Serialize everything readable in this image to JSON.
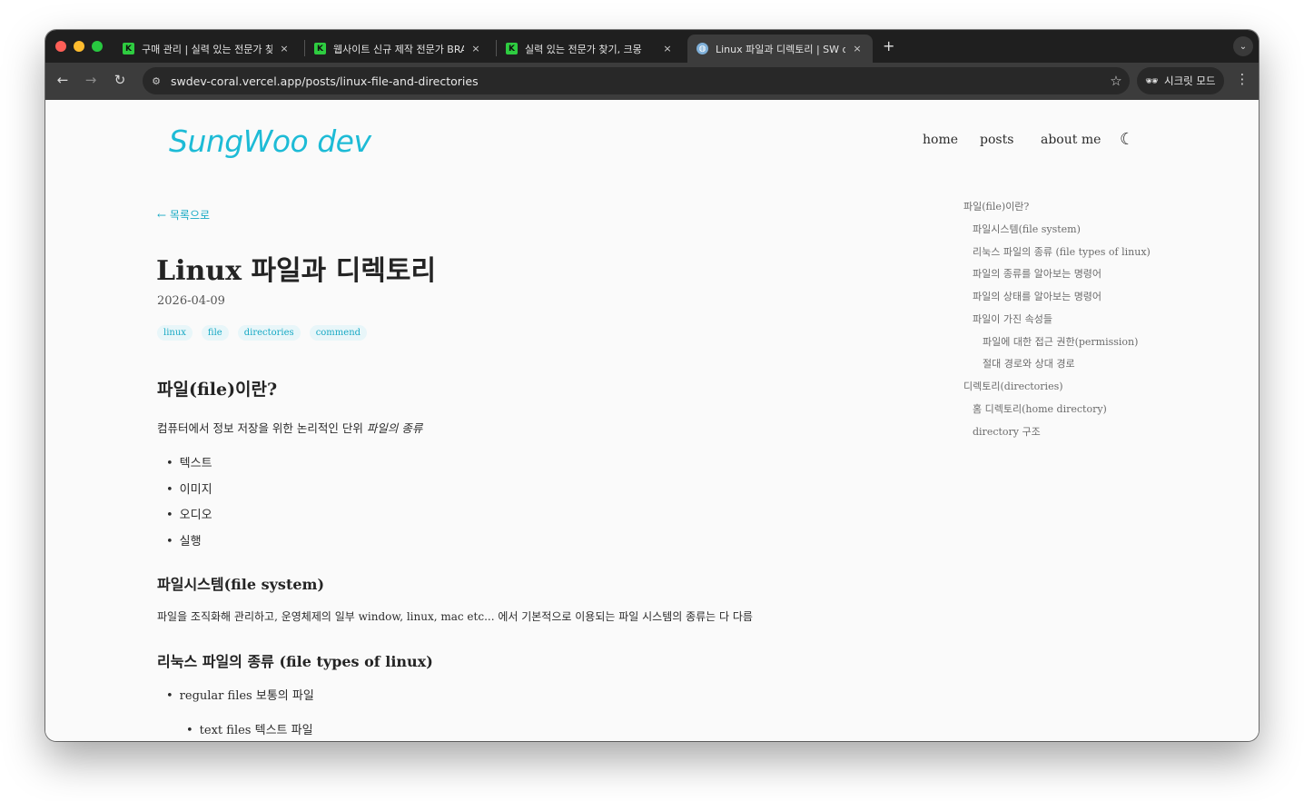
{
  "browser": {
    "tabs": [
      {
        "title": "구매 관리 | 실력 있는 전문가 찾기,",
        "favicon": "K"
      },
      {
        "title": "웹사이트 신규 제작 전문가 BRAZE",
        "favicon": "K"
      },
      {
        "title": "실력 있는 전문가 찾기, 크몽",
        "favicon": "K"
      },
      {
        "title": "Linux 파일과 디렉토리 | SW dev",
        "favicon": "globe"
      }
    ],
    "close_symbol": "×",
    "new_tab_symbol": "+",
    "url": "swdev-coral.vercel.app/posts/linux-file-and-directories",
    "incognito_label": "시크릿 모드"
  },
  "site": {
    "logo": "SungWoo dev",
    "nav": {
      "home": "home",
      "posts": "posts",
      "about": "about me"
    }
  },
  "post": {
    "back_link": "← 목록으로",
    "title": "Linux 파일과 디렉토리",
    "date": "2026-04-09",
    "tags": [
      "linux",
      "file",
      "directories",
      "commend"
    ],
    "sections": {
      "h_file": "파일(file)이란?",
      "p_file_main": "컴퓨터에서 정보 저장을 위한 논리적인 단위",
      "p_file_em": "파일의 종류",
      "file_types": [
        "텍스트",
        "이미지",
        "오디오",
        "실행"
      ],
      "h_fs": "파일시스템(file system)",
      "p_fs": "파일을 조직화해 관리하고, 운영체제의 일부 window, linux, mac etc... 에서 기본적으로 이용되는 파일 시스템의 종류는 다 다름",
      "h_linux_types": "리눅스 파일의 종류 (file types of linux)",
      "li_regular": "regular files 보통의 파일",
      "li_text": "text files 텍스트 파일"
    }
  },
  "toc": [
    {
      "label": "파일(file)이란?",
      "level": 1
    },
    {
      "label": "파일시스템(file system)",
      "level": 2
    },
    {
      "label": "리눅스 파일의 종류 (file types of linux)",
      "level": 2
    },
    {
      "label": "파일의 종류를 알아보는 명령어",
      "level": 2
    },
    {
      "label": "파일의 상태를 알아보는 명령어",
      "level": 2
    },
    {
      "label": "파일이 가진 속성들",
      "level": 2
    },
    {
      "label": "파일에 대한 접근 권한(permission)",
      "level": 3
    },
    {
      "label": "절대 경로와 상대 경로",
      "level": 3
    },
    {
      "label": "디렉토리(directories)",
      "level": 1
    },
    {
      "label": "홈 디렉토리(home directory)",
      "level": 2
    },
    {
      "label": "directory 구조",
      "level": 2
    }
  ],
  "colors": {
    "accent": "#1dbbd6",
    "tab_bar": "#1f1f1f",
    "toolbar": "#3c3c3c"
  },
  "icons": [
    "back-arrow-icon",
    "forward-arrow-icon",
    "reload-icon",
    "site-info-icon",
    "bookmark-star-icon",
    "incognito-icon",
    "menu-kebab-icon",
    "dark-mode-moon-icon"
  ]
}
